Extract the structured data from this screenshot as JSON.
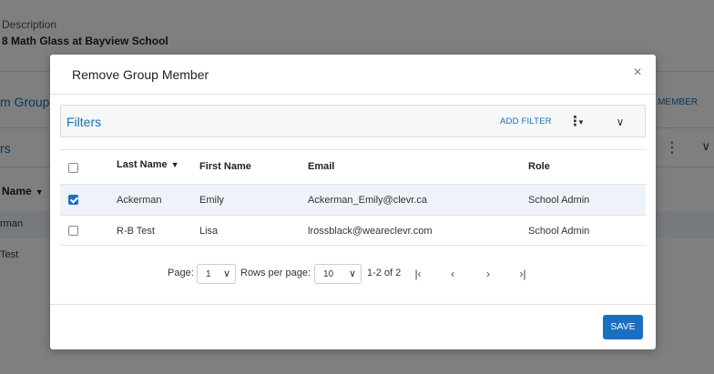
{
  "background": {
    "description_label": "Description",
    "description_value": "8 Math Glass at Bayview School",
    "group_tab": "m Group",
    "add_member": "D MEMBER",
    "filters": "rs",
    "name_header": "Name",
    "row1": "rman",
    "row2": "Test"
  },
  "modal": {
    "title": "Remove Group Member",
    "close_glyph": "×",
    "filters": {
      "title": "Filters",
      "add_filter": "ADD FILTER",
      "kebab_glyph": "⋮",
      "caret_glyph": "▼",
      "collapse_glyph": "∨"
    },
    "table": {
      "columns": {
        "last_name": "Last Name",
        "first_name": "First Name",
        "email": "Email",
        "role": "Role"
      },
      "sort_glyph": "▼",
      "rows": [
        {
          "checked": true,
          "last_name": "Ackerman",
          "first_name": "Emily",
          "email": "Ackerman_Emily@clevr.ca",
          "role": "School Admin"
        },
        {
          "checked": false,
          "last_name": "R-B Test",
          "first_name": "Lisa",
          "email": "lrossblack@weareclevr.com",
          "role": "School Admin"
        }
      ]
    },
    "pagination": {
      "page_label": "Page:",
      "page_value": "1",
      "rows_label": "Rows per page:",
      "rows_value": "10",
      "range": "1-2 of 2",
      "first_glyph": "|‹",
      "prev_glyph": "‹",
      "next_glyph": "›",
      "last_glyph": "›|",
      "dropdown_glyph": "∨"
    },
    "save_label": "SAVE"
  },
  "colors": {
    "accent": "#1b6fc0",
    "link": "#1a6fb0",
    "selected_row": "#edf3f9"
  }
}
